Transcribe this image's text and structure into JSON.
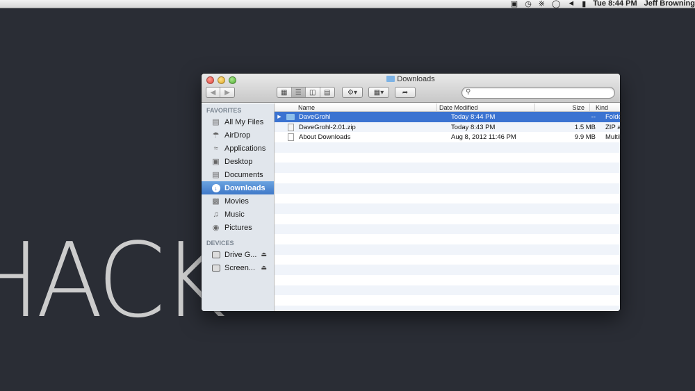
{
  "menubar": {
    "status_icons": [
      "display-mirror-icon",
      "time-machine-icon",
      "bluetooth-icon",
      "wifi-icon",
      "volume-icon",
      "battery-icon"
    ],
    "clock": "Tue 8:44 PM",
    "user": "Jeff Browning"
  },
  "background": {
    "logo_text": "HACK"
  },
  "window": {
    "title": "Downloads",
    "search": {
      "value": "",
      "placeholder": ""
    },
    "sidebar": {
      "favorites_header": "FAVORITES",
      "favorites": [
        {
          "label": "All My Files",
          "icon": "all-files-icon"
        },
        {
          "label": "AirDrop",
          "icon": "airdrop-icon"
        },
        {
          "label": "Applications",
          "icon": "applications-icon"
        },
        {
          "label": "Desktop",
          "icon": "desktop-icon"
        },
        {
          "label": "Documents",
          "icon": "documents-icon"
        },
        {
          "label": "Downloads",
          "icon": "downloads-icon",
          "selected": true
        },
        {
          "label": "Movies",
          "icon": "movies-icon"
        },
        {
          "label": "Music",
          "icon": "music-icon"
        },
        {
          "label": "Pictures",
          "icon": "pictures-icon"
        }
      ],
      "devices_header": "DEVICES",
      "devices": [
        {
          "label": "Drive G...",
          "icon": "drive-icon"
        },
        {
          "label": "Screen...",
          "icon": "drive-icon"
        }
      ]
    },
    "columns": {
      "name": "Name",
      "date": "Date Modified",
      "size": "Size",
      "kind": "Kind"
    },
    "files": [
      {
        "name": "DaveGrohl",
        "date": "Today 8:44 PM",
        "size": "--",
        "kind": "Folder",
        "type": "folder",
        "selected": true
      },
      {
        "name": "DaveGrohl-2.01.zip",
        "date": "Today 8:43 PM",
        "size": "1.5 MB",
        "kind": "ZIP arch",
        "type": "zip"
      },
      {
        "name": "About Downloads",
        "date": "Aug 8, 2012 11:46 PM",
        "size": "9.9 MB",
        "kind": "Multili...",
        "type": "doc"
      }
    ]
  },
  "colors": {
    "selection": "#3b73d1",
    "sidebar_bg": "#e1e6ec",
    "desktop_bg": "#2a2d35"
  }
}
